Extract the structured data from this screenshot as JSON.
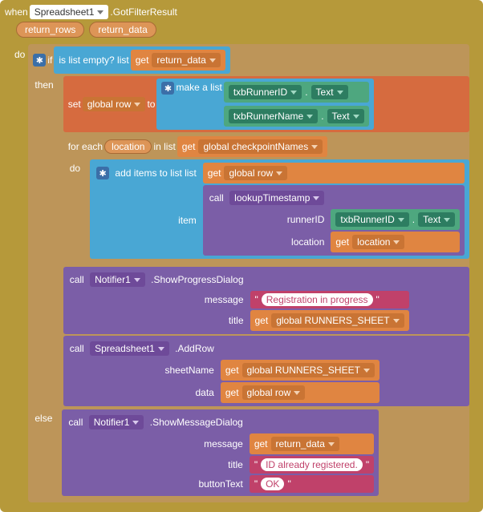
{
  "event": {
    "when": "when",
    "component": "Spreadsheet1",
    "method": ".GotFilterResult",
    "params": [
      "return_rows",
      "return_data"
    ]
  },
  "do": "do",
  "if_kw": "if",
  "then_kw": "then",
  "else_kw": "else",
  "for_kw": "for each",
  "in_list_kw": "in list",
  "do_kw": "do",
  "is_list_empty": "is list empty?  list",
  "get": "get",
  "var_return_data": "return_data",
  "set_kw": "set",
  "to_kw": "to",
  "var_global_row": "global row",
  "make_a_list": "make a list",
  "txb_runner_id": "txbRunnerID",
  "txb_runner_name": "txbRunnerName",
  "dot_text": ".",
  "prop_text": "Text",
  "foreach_var": "location",
  "checkpoint_names": "global checkpointNames",
  "add_items_to_list": "add items to list  list",
  "item_kw": "item",
  "call_kw": "call",
  "lookup_ts": "lookupTimestamp",
  "arg_runnerID": "runnerID",
  "arg_location": "location",
  "var_location": "location",
  "call_notifier": "Notifier1",
  "show_progress": ".ShowProgressDialog",
  "arg_message": "message",
  "arg_title": "title",
  "txt_registration": "Registration in progress",
  "runners_sheet": "global RUNNERS_SHEET",
  "call_spreadsheet": "Spreadsheet1",
  "add_row": ".AddRow",
  "arg_sheetName": "sheetName",
  "arg_data": "data",
  "show_msg": ".ShowMessageDialog",
  "arg_buttonText": "buttonText",
  "txt_already": "ID already registered.",
  "txt_ok": "OK",
  "q1": "\"",
  "q2": "\""
}
